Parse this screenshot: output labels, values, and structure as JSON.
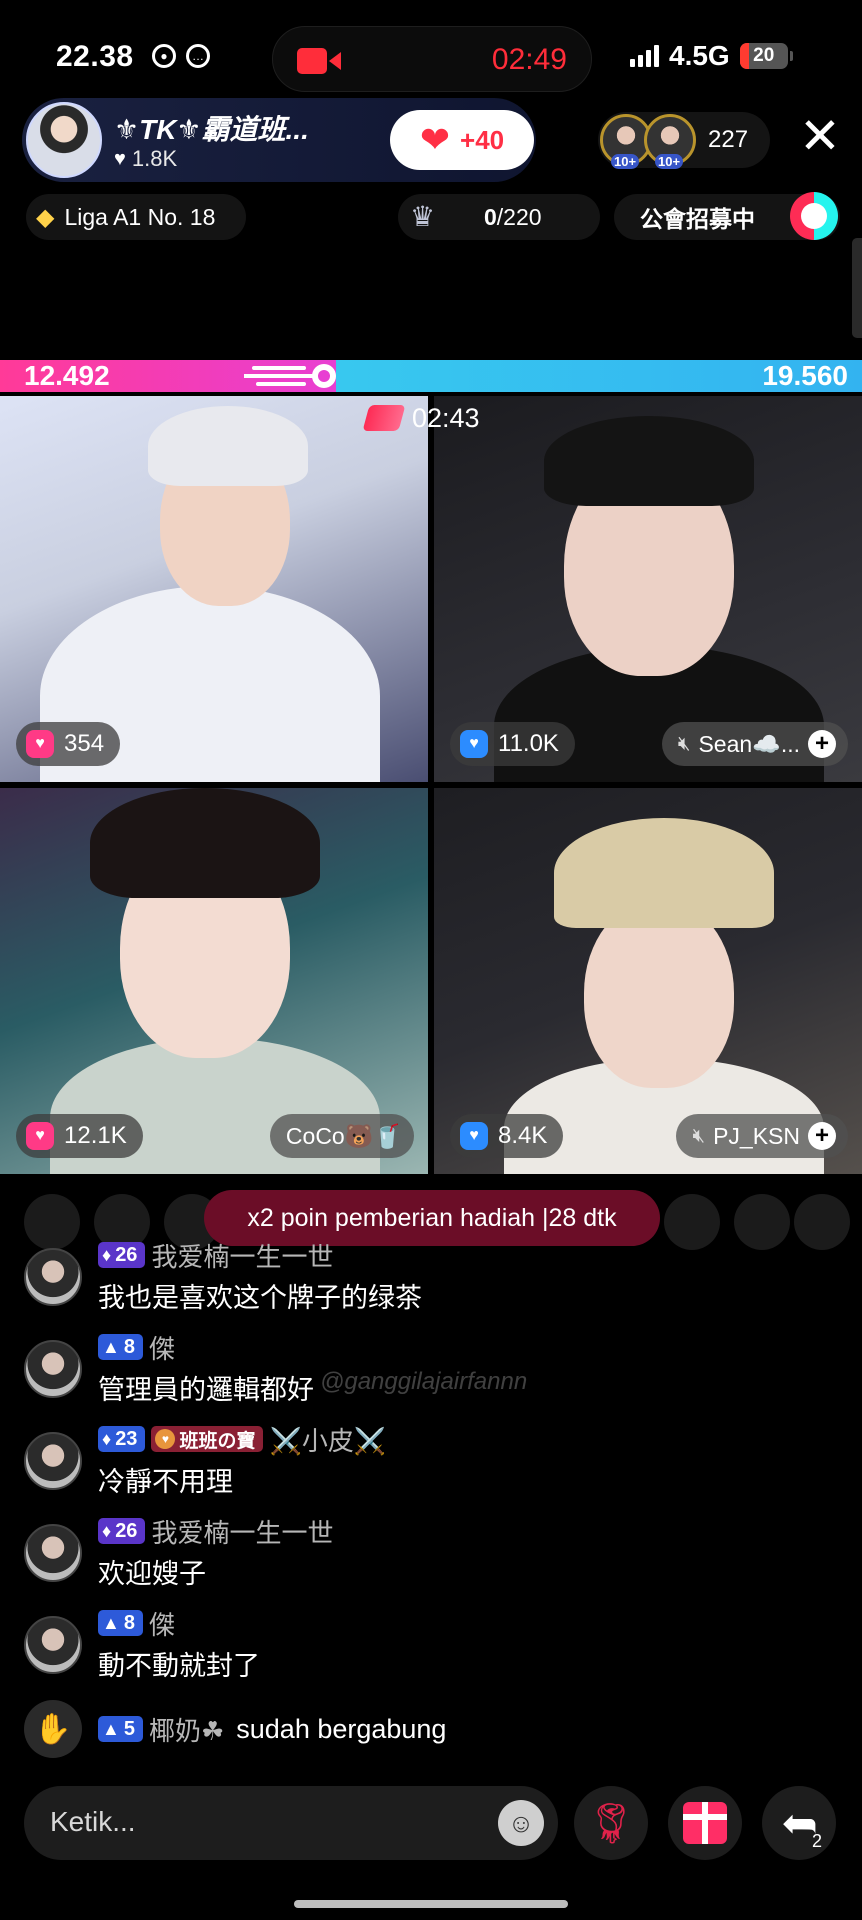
{
  "status_bar": {
    "time": "22.38",
    "recording_time": "02:49",
    "network": "4.5G",
    "battery": "20"
  },
  "host": {
    "name": "⚜TK⚜霸道班...",
    "likes": "1.8K",
    "follow_label": "+40"
  },
  "viewers": {
    "count": "227",
    "badge_1": "10+",
    "badge_2": "10+"
  },
  "chips": {
    "league": "Liga A1 No. 18",
    "rank_current": "0",
    "rank_total": "/220",
    "guild": "公會招募中"
  },
  "battle": {
    "left_score": "12.492",
    "right_score": "19.560",
    "left_share": 0.39,
    "timer": "02:43"
  },
  "tiles": [
    {
      "score": "354",
      "icon": "pink-heart-icon"
    },
    {
      "score": "11.0K",
      "name": "Sean☁️...",
      "muted": true
    },
    {
      "score": "12.1K",
      "name": "CoCo🐻🥤"
    },
    {
      "score": "8.4K",
      "name": "PJ_KSN",
      "muted": true
    }
  ],
  "boost_banner": "x2 poin pemberian hadiah  |28 dtk",
  "chat": [
    {
      "level": "26",
      "user": "我爱楠一生一世",
      "text": "我也是喜欢这个牌子的绿茶"
    },
    {
      "level": "8",
      "user": "傑",
      "text": "管理員的邏輯都好"
    },
    {
      "level": "23",
      "badge": "班班の寶",
      "user": "⚔️小皮⚔️",
      "text": "冷靜不用理"
    },
    {
      "level": "26",
      "user": "我爱楠一生一世",
      "text": "欢迎嫂子"
    },
    {
      "level": "8",
      "user": "傑",
      "text": "動不動就封了"
    }
  ],
  "join": {
    "level": "5",
    "user": "椰奶☘",
    "text": "sudah bergabung"
  },
  "watermark": "@ganggilajairfannn",
  "bottom": {
    "placeholder": "Ketik...",
    "share_count": "2"
  },
  "colors": {
    "battle_left": "#ff3a98",
    "battle_right": "#38c8ef",
    "record": "#ff2d3a",
    "banner": "#6b0d27"
  }
}
